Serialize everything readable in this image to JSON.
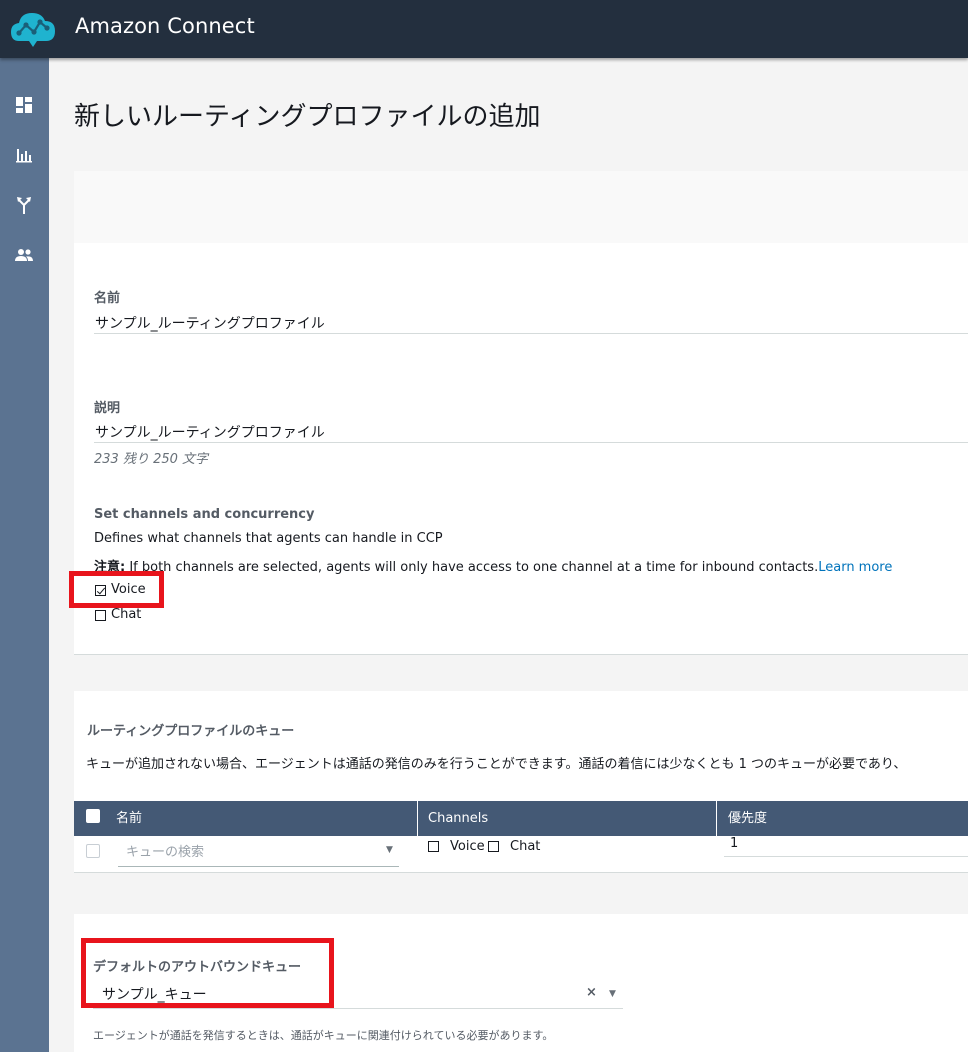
{
  "header": {
    "app_title": "Amazon Connect"
  },
  "sidebar": {
    "items": [
      {
        "icon": "dashboard-icon"
      },
      {
        "icon": "bar-chart-icon"
      },
      {
        "icon": "routing-icon"
      },
      {
        "icon": "users-icon"
      }
    ]
  },
  "page": {
    "title": "新しいルーティングプロファイルの追加"
  },
  "form": {
    "name_label": "名前",
    "name_value": "サンプル_ルーティングプロファイル",
    "description_label": "説明",
    "description_value": "サンプル_ルーティングプロファイル",
    "char_count": "233 残り 250 文字",
    "channels_title": "Set channels and concurrency",
    "channels_desc": "Defines what channels that agents can handle in CCP",
    "note_label": "注意:",
    "note_text": " If both channels are selected, agents will only have access to one channel at a time for inbound contacts.",
    "learn_more": "Learn more",
    "voice_label": "Voice",
    "voice_checked": true,
    "chat_label": "Chat",
    "chat_checked": false
  },
  "queues": {
    "title": "ルーティングプロファイルのキュー",
    "desc": "キューが追加されない場合、エージェントは通話の発信のみを行うことができます。通話の着信には少なくとも 1 つのキューが必要であり、",
    "columns": {
      "name": "名前",
      "channels": "Channels",
      "priority": "優先度"
    },
    "row": {
      "search_placeholder": "キューの検索",
      "voice_label": "Voice",
      "chat_label": "Chat",
      "priority_value": "1"
    }
  },
  "outbound": {
    "label": "デフォルトのアウトバウンドキュー",
    "value": "サンプル_キュー",
    "clear_glyph": "×",
    "note": "エージェントが通話を発信するときは、通話がキューに関連付けられている必要があります。"
  },
  "colors": {
    "topbar": "#232f3e",
    "sidebar": "#5b7391",
    "table_header": "#445975",
    "highlight": "#e8141c",
    "link": "#0073bb"
  }
}
